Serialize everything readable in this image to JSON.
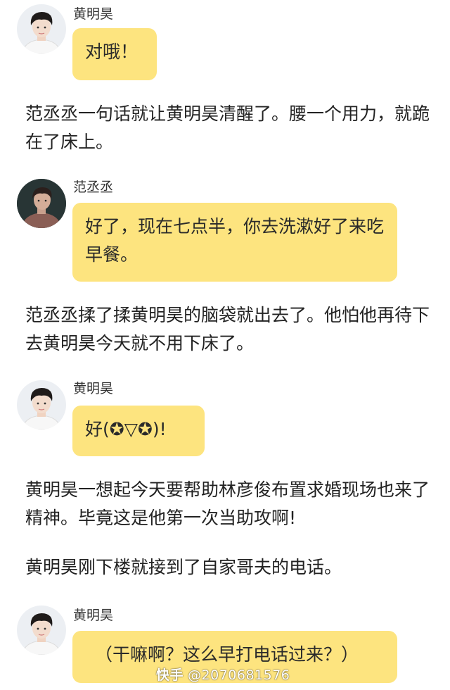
{
  "messages": [
    {
      "sender": "黄明昊",
      "text": "对哦！",
      "avatar_icon": "boy-portrait-avatar"
    },
    {
      "narration": "范丞丞一句话就让黄明昊清醒了。腰一个用力，就跪在了床上。"
    },
    {
      "sender": "范丞丞",
      "text": "好了，现在七点半，你去洗漱好了来吃早餐。",
      "avatar_icon": "man-portrait-avatar"
    },
    {
      "narration": "范丞丞揉了揉黄明昊的脑袋就出去了。他怕他再待下去黄明昊今天就不用下床了。"
    },
    {
      "sender": "黄明昊",
      "text": "好(✪▽✪)!",
      "avatar_icon": "boy-portrait-avatar"
    },
    {
      "narration": "黄明昊一想起今天要帮助林彦俊布置求婚现场也来了精神。毕竟这是他第一次当助攻啊!"
    },
    {
      "narration": "黄明昊刚下楼就接到了自家哥夫的电话。"
    },
    {
      "sender": "黄明昊",
      "text": "（干嘛啊？这么早打电话过来？）",
      "avatar_icon": "boy-portrait-avatar"
    }
  ],
  "watermark": {
    "brand": "快手",
    "handle": "@2070681576"
  },
  "colors": {
    "bubble": "#fde47f",
    "background": "#ffffff",
    "text": "#222222"
  }
}
